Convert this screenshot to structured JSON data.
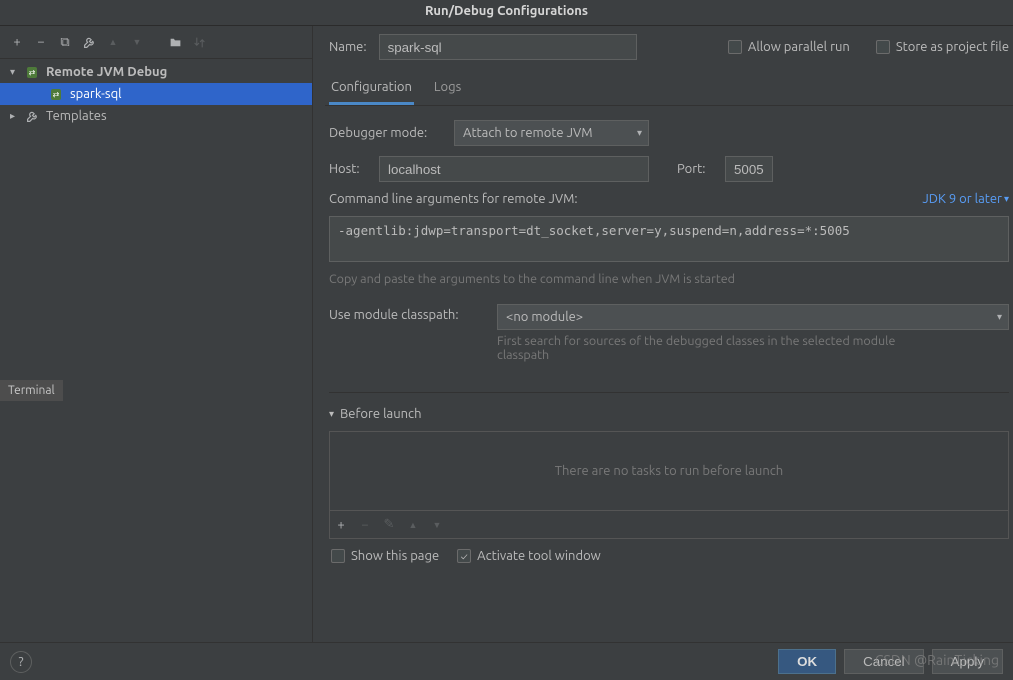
{
  "title": "Run/Debug Configurations",
  "toolbar_icons": {
    "add": "+",
    "remove": "−",
    "copy": "⧉",
    "wrench": "🔧",
    "up": "▲",
    "down": "▼",
    "folder": "📁",
    "sort": "↕"
  },
  "tree": {
    "root": {
      "label": "Remote JVM Debug"
    },
    "child": {
      "label": "spark-sql"
    },
    "templates": {
      "label": "Templates"
    }
  },
  "name_label": "Name:",
  "name_value": "spark-sql",
  "allow_parallel": "Allow parallel run",
  "store_project": "Store as project file",
  "tabs": {
    "config": "Configuration",
    "logs": "Logs"
  },
  "debugger_mode_label": "Debugger mode:",
  "debugger_mode_value": "Attach to remote JVM",
  "host_label": "Host:",
  "host_value": "localhost",
  "port_label": "Port:",
  "port_value": "5005",
  "cmd_header": "Command line arguments for remote JVM:",
  "jdk_link": "JDK 9 or later",
  "cmd_value": "-agentlib:jdwp=transport=dt_socket,server=y,suspend=n,address=*:5005",
  "cmd_hint": "Copy and paste the arguments to the command line when JVM is started",
  "module_label": "Use module classpath:",
  "module_value": "<no module>",
  "module_hint": "First search for sources of the debugged classes in the selected module classpath",
  "before_launch": "Before launch",
  "bl_empty": "There are no tasks to run before launch",
  "show_page": "Show this page",
  "activate_tw": "Activate tool window",
  "ok": "OK",
  "cancel": "Cancel",
  "apply": "Apply",
  "terminal": "Terminal",
  "watermark": "CSDN @RainTicking"
}
